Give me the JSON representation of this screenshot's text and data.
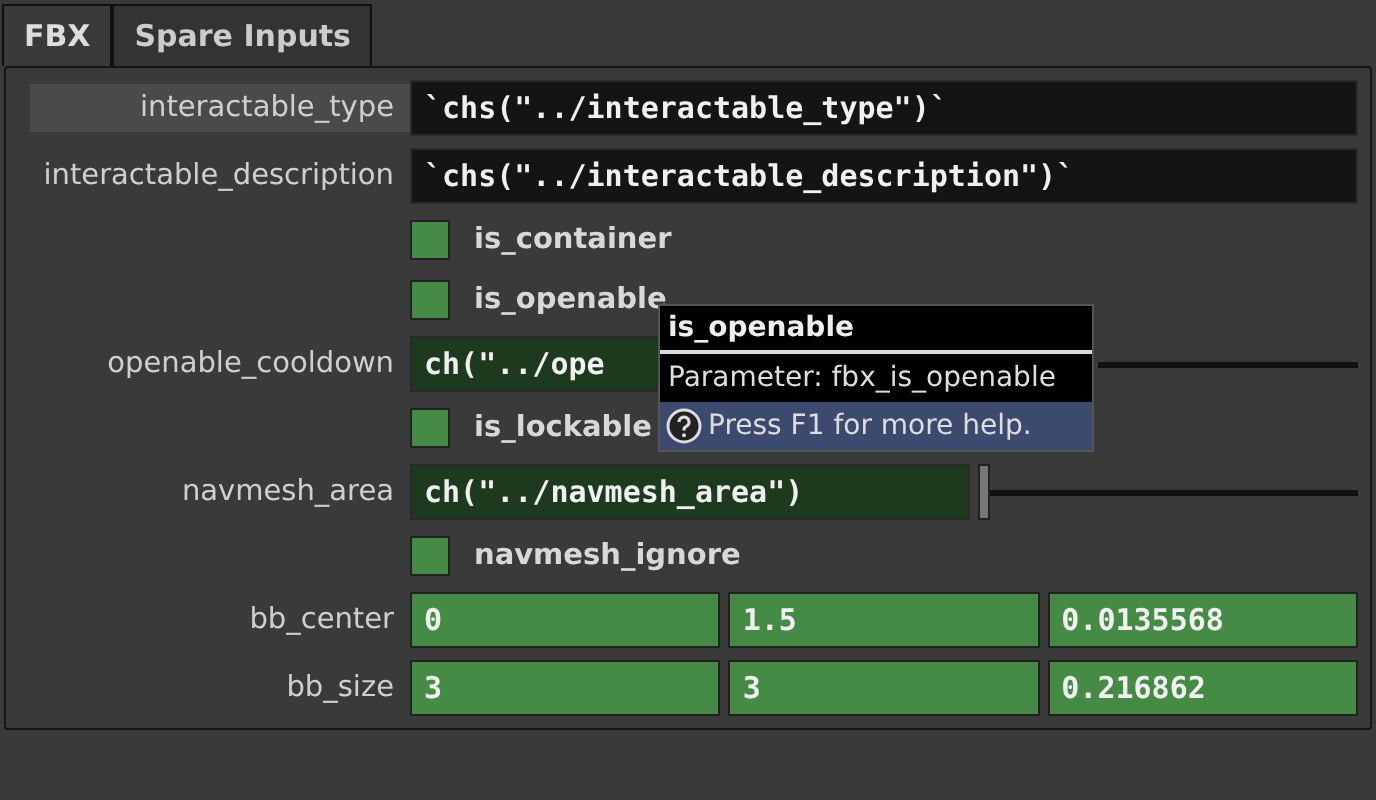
{
  "tabs": [
    {
      "label": "FBX",
      "selected": true
    },
    {
      "label": "Spare Inputs",
      "selected": false
    }
  ],
  "parameters": [
    {
      "kind": "text",
      "label": "interactable_type",
      "highlighted": true,
      "value": "`chs(\"../interactable_type\")`"
    },
    {
      "kind": "text",
      "label": "interactable_description",
      "highlighted": false,
      "value": "`chs(\"../interactable_description\")`"
    },
    {
      "kind": "checkbox",
      "label": "is_container",
      "checked": false
    },
    {
      "kind": "checkbox",
      "label": "is_openable",
      "checked": false
    },
    {
      "kind": "slider",
      "label": "openable_cooldown",
      "value": "ch(\"../ope"
    },
    {
      "kind": "checkbox",
      "label": "is_lockable",
      "checked": false
    },
    {
      "kind": "slider",
      "label": "navmesh_area",
      "value": "ch(\"../navmesh_area\")",
      "level": 0
    },
    {
      "kind": "checkbox",
      "label": "navmesh_ignore",
      "checked": false
    },
    {
      "kind": "vector",
      "label": "bb_center",
      "values": [
        "0",
        "1.5",
        "0.0135568"
      ]
    },
    {
      "kind": "vector",
      "label": "bb_size",
      "values": [
        "3",
        "3",
        "0.216862"
      ]
    }
  ],
  "tooltip": {
    "title": "is_openable",
    "parameter": "Parameter: fbx_is_openable",
    "help": "Press F1 for more help."
  }
}
